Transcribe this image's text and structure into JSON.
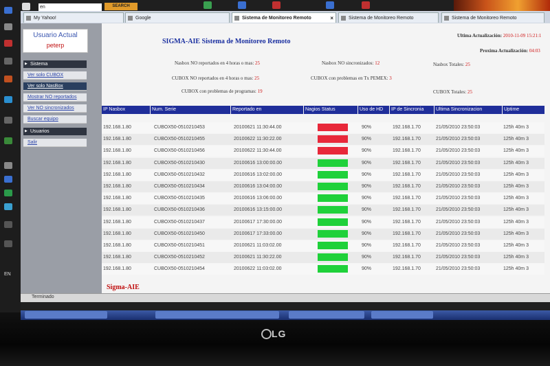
{
  "browser": {
    "search_value": "en",
    "search_button": "SEARCH",
    "tabs": [
      {
        "label": "My Yahoo!"
      },
      {
        "label": "Google"
      },
      {
        "label": "Sistema de Monitoreo Remoto"
      },
      {
        "label": "Sistema de Monitoreo Remoto"
      },
      {
        "label": "Sistema de Monitoreo Remoto"
      }
    ],
    "status": "Terminado"
  },
  "os": {
    "left_label": "EN"
  },
  "monitor": {
    "brand": "LG"
  },
  "sidebar": {
    "user_title": "Usuario Actual",
    "user_name": "peterp",
    "sections": [
      {
        "label": "Sistema",
        "links": [
          "Ver solo CUBOX",
          "Ver solo NasBox",
          "Mostrar NO reportados",
          "Ver NO sincronizados",
          "Buscar equipo"
        ]
      },
      {
        "label": "Usuarios",
        "links": [
          "Salir"
        ]
      }
    ]
  },
  "header": {
    "title": "SIGMA-AIE Sistema de Monitoreo Remoto",
    "last_update_label": "Ultima Actualización:",
    "last_update_value": "2010-11-09 15:21:1",
    "next_update_label": "Proxima Actualización:",
    "next_update_value": "04:03"
  },
  "summary": {
    "nasbox_no_reportados_label": "Nasbox NO reportados en 4 horas o mas:",
    "nasbox_no_reportados_value": "25",
    "nasbox_no_sincronizados_label": "Nasbox NO sincronizados:",
    "nasbox_no_sincronizados_value": "12",
    "nasbox_totales_label": "Nasbox Totales:",
    "nasbox_totales_value": "25",
    "cubox_no_reportados_label": "CUBOX NO reportados en 4 horas o mas:",
    "cubox_no_reportados_value": "25",
    "cubox_pemex_label": "CUBOX con problemas en Tx PEMEX:",
    "cubox_pemex_value": "3",
    "cubox_programas_label": "CUBOX con problemas de programas:",
    "cubox_programas_value": "19",
    "cubox_totales_label": "CUBOX Totales:",
    "cubox_totales_value": "25"
  },
  "table": {
    "columns": [
      "IP Nasbox",
      "Num. Serie",
      "Reportado en",
      "Nagios Status",
      "Uso de HD",
      "IP de Sincronia",
      "Ultima Sincronizacion",
      "Uptime"
    ],
    "rows": [
      {
        "ip": "192.168.1.80",
        "serie": "CUBOX50-0510210453",
        "reportado": "20100621 11:30:44.00",
        "status": "red",
        "hd": "90%",
        "ip_sync": "192.168.1.70",
        "ultima": "21/05/2010 23:50:03",
        "uptime": "125h 40m 3"
      },
      {
        "ip": "192.168.1.80",
        "serie": "CUBOX50-0510210455",
        "reportado": "20100622 11:30:22.00",
        "status": "red",
        "hd": "90%",
        "ip_sync": "192.168.1.70",
        "ultima": "21/05/2010 23:50:03",
        "uptime": "125h 40m 3"
      },
      {
        "ip": "192.168.1.80",
        "serie": "CUBOX50-0510210456",
        "reportado": "20100622 11:30:44.00",
        "status": "red",
        "hd": "90%",
        "ip_sync": "192.168.1.70",
        "ultima": "21/05/2010 23:50:03",
        "uptime": "125h 40m 3"
      },
      {
        "ip": "192.168.1.80",
        "serie": "CUBOX50-0510210430",
        "reportado": "20100616 13:00:00.00",
        "status": "green",
        "hd": "90%",
        "ip_sync": "192.168.1.70",
        "ultima": "21/05/2010 23:50:03",
        "uptime": "125h 40m 3"
      },
      {
        "ip": "192.168.1.80",
        "serie": "CUBOX50-0510210432",
        "reportado": "20100616 13:02:00.00",
        "status": "green",
        "hd": "90%",
        "ip_sync": "192.168.1.70",
        "ultima": "21/05/2010 23:50:03",
        "uptime": "125h 40m 3"
      },
      {
        "ip": "192.168.1.80",
        "serie": "CUBOX50-0510210434",
        "reportado": "20100616 13:04:00.00",
        "status": "green",
        "hd": "90%",
        "ip_sync": "192.168.1.70",
        "ultima": "21/05/2010 23:50:03",
        "uptime": "125h 40m 3"
      },
      {
        "ip": "192.168.1.80",
        "serie": "CUBOX50-0510210435",
        "reportado": "20100616 13:06:00.00",
        "status": "green",
        "hd": "90%",
        "ip_sync": "192.168.1.70",
        "ultima": "21/05/2010 23:50:03",
        "uptime": "125h 40m 3"
      },
      {
        "ip": "192.168.1.80",
        "serie": "CUBOX50-0510210436",
        "reportado": "20100616 13:15:00.00",
        "status": "green",
        "hd": "90%",
        "ip_sync": "192.168.1.70",
        "ultima": "21/05/2010 23:50:03",
        "uptime": "125h 40m 3"
      },
      {
        "ip": "192.168.1.80",
        "serie": "CUBOX50-0510210437",
        "reportado": "20100617 17:30:00.00",
        "status": "green",
        "hd": "90%",
        "ip_sync": "192.168.1.70",
        "ultima": "21/05/2010 23:50:03",
        "uptime": "125h 40m 3"
      },
      {
        "ip": "192.168.1.80",
        "serie": "CUBOX50-0510210450",
        "reportado": "20100617 17:33:00.00",
        "status": "green",
        "hd": "90%",
        "ip_sync": "192.168.1.70",
        "ultima": "21/05/2010 23:50:03",
        "uptime": "125h 40m 3"
      },
      {
        "ip": "192.168.1.80",
        "serie": "CUBOX50-0510210451",
        "reportado": "20100621 11:03:02.00",
        "status": "green",
        "hd": "90%",
        "ip_sync": "192.168.1.70",
        "ultima": "21/05/2010 23:50:03",
        "uptime": "125h 40m 3"
      },
      {
        "ip": "192.168.1.80",
        "serie": "CUBOX50-0510210452",
        "reportado": "20100621 11:30:22.00",
        "status": "green",
        "hd": "90%",
        "ip_sync": "192.168.1.70",
        "ultima": "21/05/2010 23:50:03",
        "uptime": "125h 40m 3"
      },
      {
        "ip": "192.168.1.80",
        "serie": "CUBOX50-0510210454",
        "reportado": "20100622 11:03:02.00",
        "status": "green",
        "hd": "90%",
        "ip_sync": "192.168.1.70",
        "ultima": "21/05/2010 23:50:03",
        "uptime": "125h 40m 3"
      }
    ]
  },
  "footer": {
    "brand": "Sigma-AIE"
  },
  "colors": {
    "status_red": "#e8283a",
    "status_green": "#1fd13a",
    "header_blue": "#1f2e9a"
  }
}
